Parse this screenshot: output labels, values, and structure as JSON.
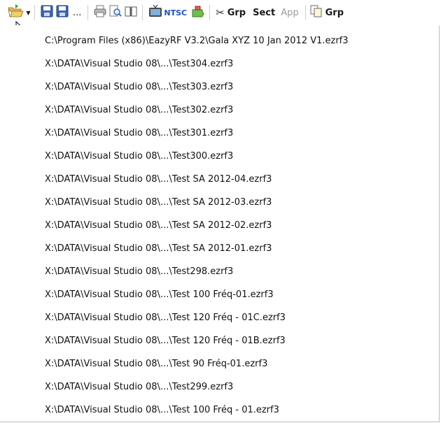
{
  "toolbar": {
    "ellipsis_label": "...",
    "ntsc_label": "NTSC",
    "grp_label": "Grp",
    "sect_label": "Sect",
    "app_label": "App",
    "grp2_label": "Grp",
    "icons": [
      "open-folder-icon",
      "save-icon",
      "save-as-icon",
      "print-icon",
      "print-preview-icon",
      "book-icon",
      "tv-icon",
      "puzzle-icon",
      "scissors-icon",
      "copy-icon"
    ]
  },
  "recent_files": [
    "C:\\Program Files (x86)\\EazyRF V3.2\\Gala XYZ  10 Jan 2012 V1.ezrf3",
    "X:\\DATA\\Visual Studio 08\\...\\Test304.ezrf3",
    "X:\\DATA\\Visual Studio 08\\...\\Test303.ezrf3",
    "X:\\DATA\\Visual Studio 08\\...\\Test302.ezrf3",
    "X:\\DATA\\Visual Studio 08\\...\\Test301.ezrf3",
    "X:\\DATA\\Visual Studio 08\\...\\Test300.ezrf3",
    "X:\\DATA\\Visual Studio 08\\...\\Test SA 2012-04.ezrf3",
    "X:\\DATA\\Visual Studio 08\\...\\Test SA 2012-03.ezrf3",
    "X:\\DATA\\Visual Studio 08\\...\\Test SA 2012-02.ezrf3",
    "X:\\DATA\\Visual Studio 08\\...\\Test SA 2012-01.ezrf3",
    "X:\\DATA\\Visual Studio 08\\...\\Test298.ezrf3",
    "X:\\DATA\\Visual Studio 08\\...\\Test 100 Fréq-01.ezrf3",
    "X:\\DATA\\Visual Studio 08\\...\\Test 120 Fréq - 01C.ezrf3",
    "X:\\DATA\\Visual Studio 08\\...\\Test 120 Fréq - 01B.ezrf3",
    "X:\\DATA\\Visual Studio 08\\...\\Test 90 Fréq-01.ezrf3",
    "X:\\DATA\\Visual Studio 08\\...\\Test299.ezrf3",
    "X:\\DATA\\Visual Studio 08\\...\\Test 100 Fréq - 01.ezrf3"
  ]
}
